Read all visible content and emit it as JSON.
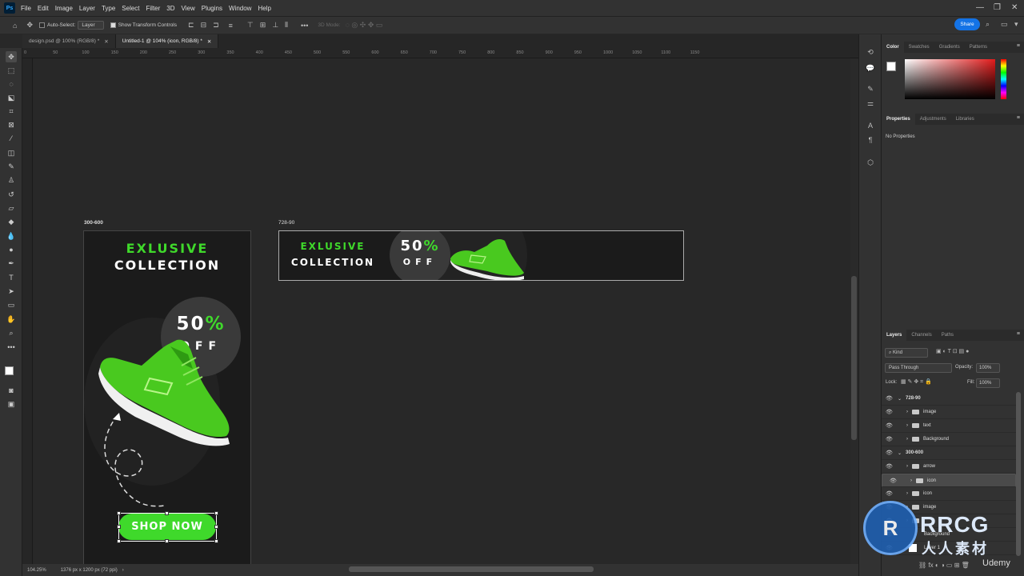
{
  "app": {
    "logo": "Ps"
  },
  "menu": [
    "File",
    "Edit",
    "Image",
    "Layer",
    "Type",
    "Select",
    "Filter",
    "3D",
    "View",
    "Plugins",
    "Window",
    "Help"
  ],
  "options": {
    "auto_select_label": "Auto-Select:",
    "auto_select_value": "Layer",
    "show_transform": "Show Transform Controls",
    "mode_3d": "3D Mode:",
    "share": "Share"
  },
  "tabs": [
    {
      "label": "design.psd @ 100% (RGB/8) *"
    },
    {
      "label": "Untitled-1 @ 104% (icon, RGB/8) *"
    }
  ],
  "ruler_h": [
    "0",
    "50",
    "100",
    "150",
    "200",
    "250",
    "300",
    "350",
    "400",
    "450",
    "500",
    "550",
    "600",
    "650",
    "700",
    "750",
    "800",
    "850",
    "900",
    "950",
    "1000",
    "1050",
    "1100",
    "1150"
  ],
  "artboards": {
    "tall": {
      "label": "300-600",
      "headline1": "EXLUSIVE",
      "headline2": "COLLECTION",
      "discount": "50",
      "percent": "%",
      "off": "OFF",
      "cta": "SHOP NOW"
    },
    "wide": {
      "label": "728-90",
      "headline1": "EXLUSIVE",
      "headline2": "COLLECTION",
      "discount": "50",
      "percent": "%",
      "off": "OFF"
    }
  },
  "status": {
    "zoom": "104.25%",
    "doc": "1376 px x 1200 px (72 ppi)"
  },
  "color_panel": {
    "tabs": [
      "Color",
      "Swatches",
      "Gradients",
      "Patterns"
    ]
  },
  "properties_panel": {
    "tabs": [
      "Properties",
      "Adjustments",
      "Libraries"
    ],
    "empty": "No Properties"
  },
  "layers_panel": {
    "tabs": [
      "Layers",
      "Channels",
      "Paths"
    ],
    "kind": "Kind",
    "blend": "Pass Through",
    "opacity_label": "Opacity:",
    "opacity": "100%",
    "lock_label": "Lock:",
    "fill_label": "Fill:",
    "fill": "100%",
    "layers": [
      {
        "name": "728-90",
        "type": "artboard"
      },
      {
        "name": "image",
        "type": "group"
      },
      {
        "name": "text",
        "type": "group"
      },
      {
        "name": "Background",
        "type": "group"
      },
      {
        "name": "300-600",
        "type": "artboard"
      },
      {
        "name": "arrow",
        "type": "group"
      },
      {
        "name": "icon",
        "type": "group",
        "selected": true
      },
      {
        "name": "icon",
        "type": "group"
      },
      {
        "name": "image",
        "type": "group"
      },
      {
        "name": "t",
        "type": "group"
      },
      {
        "name": "Background",
        "type": "layer"
      },
      {
        "name": "Layer 1",
        "type": "layer"
      }
    ]
  },
  "watermark": {
    "brand": "RRCG",
    "cn": "人人素材",
    "udemy": "Udemy"
  },
  "colors": {
    "accent_green": "#3fd92b",
    "banner_bg": "#1b1b1b",
    "selection_blue": "#1473e6"
  }
}
